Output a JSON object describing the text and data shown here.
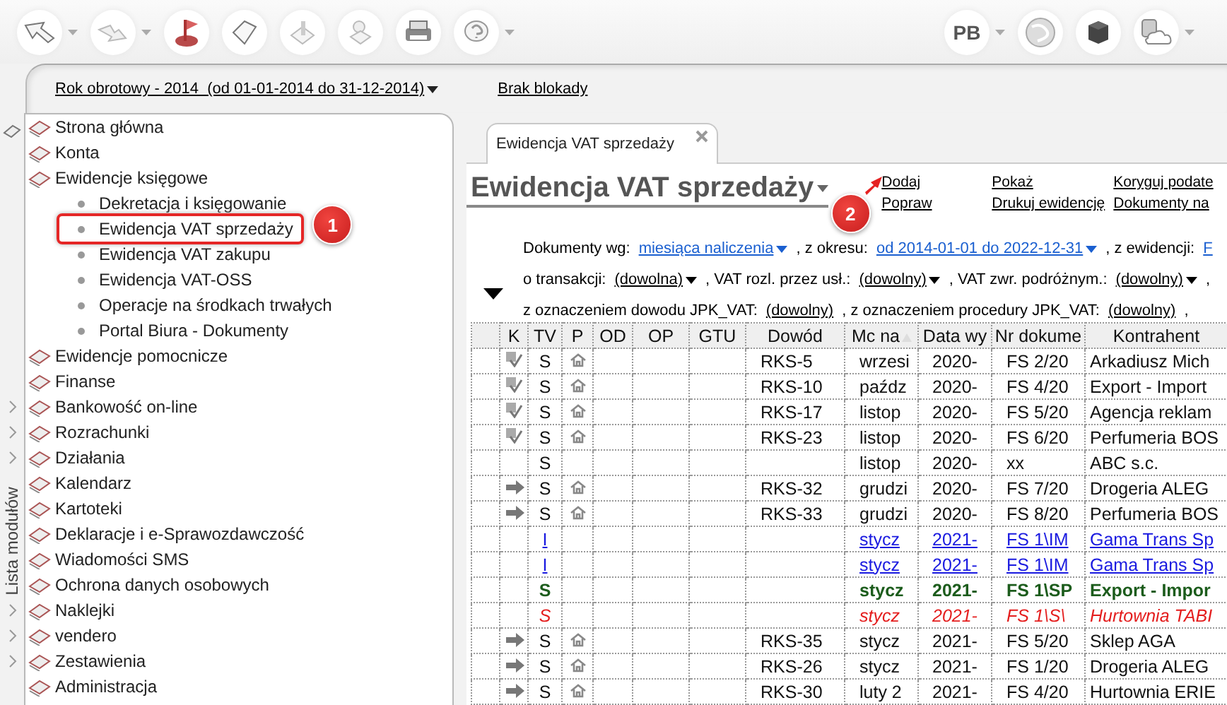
{
  "toolbar": {
    "user_initials": "PB"
  },
  "fiscal_year": {
    "label": "Rok obrotowy - 2014  (od 01-01-2014 do 31-12-2014)",
    "lock": "Brak blokady"
  },
  "sidebar": {
    "title": "Lista modułów",
    "items": [
      {
        "label": "Strona główna",
        "expandable": false
      },
      {
        "label": "Konta",
        "expandable": false
      },
      {
        "label": "Ewidencje księgowe",
        "expandable": false,
        "children": [
          {
            "label": "Dekretacja i księgowanie"
          },
          {
            "label": "Ewidencja VAT sprzedaży",
            "callout": "1"
          },
          {
            "label": "Ewidencja VAT zakupu"
          },
          {
            "label": "Ewidencja VAT-OSS"
          },
          {
            "label": "Operacje na środkach trwałych"
          },
          {
            "label": "Portal Biura - Dokumenty"
          }
        ]
      },
      {
        "label": "Ewidencje pomocnicze",
        "expandable": false
      },
      {
        "label": "Finanse",
        "expandable": false
      },
      {
        "label": "Bankowość on-line",
        "expandable": true
      },
      {
        "label": "Rozrachunki",
        "expandable": true
      },
      {
        "label": "Działania",
        "expandable": true
      },
      {
        "label": "Kalendarz",
        "expandable": false
      },
      {
        "label": "Kartoteki",
        "expandable": false
      },
      {
        "label": "Deklaracje i e-Sprawozdawczość",
        "expandable": false
      },
      {
        "label": "Wiadomości SMS",
        "expandable": false
      },
      {
        "label": "Ochrona danych osobowych",
        "expandable": false
      },
      {
        "label": "Naklejki",
        "expandable": true
      },
      {
        "label": "vendero",
        "expandable": true
      },
      {
        "label": "Zestawienia",
        "expandable": true
      },
      {
        "label": "Administracja",
        "expandable": false
      }
    ]
  },
  "tabs": [
    {
      "label": "Ewidencja VAT sprzedaży",
      "selected": true
    }
  ],
  "view": {
    "title": "Ewidencja VAT sprzedaży",
    "actions": [
      [
        {
          "label": "Dodaj",
          "callout": "2"
        },
        {
          "label": "Popraw"
        }
      ],
      [
        {
          "label": "Pokaż"
        },
        {
          "label": "Drukuj ewidencję"
        }
      ],
      [
        {
          "label": "Koryguj podate"
        },
        {
          "label": "Dokumenty na"
        }
      ]
    ],
    "filters": [
      [
        {
          "kind": "label",
          "text": "Dokumenty wg:"
        },
        {
          "kind": "link",
          "text": "miesiąca naliczenia",
          "dropdown": true
        },
        {
          "kind": "label",
          "text": ", z okresu:"
        },
        {
          "kind": "link",
          "text": "od 2014-01-01 do 2022-12-31",
          "dropdown": true
        },
        {
          "kind": "label",
          "text": ", z ewidencji:"
        },
        {
          "kind": "link",
          "text": "F",
          "dropdown": false
        }
      ],
      [
        {
          "kind": "label",
          "text": "o transakcji:"
        },
        {
          "kind": "value",
          "text": "(dowolna)",
          "dropdown": true
        },
        {
          "kind": "label",
          "text": ", VAT rozl. przez usł.:"
        },
        {
          "kind": "value",
          "text": "(dowolny)",
          "dropdown": true
        },
        {
          "kind": "label",
          "text": ", VAT zwr. podróżnym.:"
        },
        {
          "kind": "value",
          "text": "(dowolny)",
          "dropdown": true
        },
        {
          "kind": "label",
          "text": ","
        }
      ],
      [
        {
          "kind": "label",
          "text": "z oznaczeniem dowodu JPK_VAT:"
        },
        {
          "kind": "value",
          "text": "(dowolny)",
          "dropdown": false
        },
        {
          "kind": "label",
          "text": ", z oznaczeniem procedury JPK_VAT:"
        },
        {
          "kind": "value",
          "text": "(dowolny)",
          "dropdown": false
        },
        {
          "kind": "label",
          "text": ","
        }
      ]
    ]
  },
  "table": {
    "columns": [
      "K",
      "TV",
      "P",
      "OD",
      "OP",
      "GTU",
      "Dowód",
      "Mc na",
      "Data wy",
      "Nr dokume",
      "Kontrahent"
    ],
    "rows": [
      {
        "kind": "normal",
        "checked": true,
        "sent": false,
        "domestic": true,
        "tv": "S",
        "dowod": "RKS-5",
        "month": "wrzesi",
        "date": "2020-",
        "number": "FS 2/20",
        "contractor": "Arkadiusz Mich"
      },
      {
        "kind": "normal",
        "checked": true,
        "sent": false,
        "domestic": true,
        "tv": "S",
        "dowod": "RKS-10",
        "month": "paźdz",
        "date": "2020-",
        "number": "FS 4/20",
        "contractor": "Export - Import"
      },
      {
        "kind": "normal",
        "checked": true,
        "sent": false,
        "domestic": true,
        "tv": "S",
        "dowod": "RKS-17",
        "month": "listop",
        "date": "2020-",
        "number": "FS 5/20",
        "contractor": "Agencja reklam"
      },
      {
        "kind": "normal",
        "checked": true,
        "sent": false,
        "domestic": true,
        "tv": "S",
        "dowod": "RKS-23",
        "month": "listop",
        "date": "2020-",
        "number": "FS 6/20",
        "contractor": "Perfumeria BOS"
      },
      {
        "kind": "normal",
        "checked": false,
        "sent": false,
        "domestic": false,
        "tv": "S",
        "month": "listop",
        "date": "2020-",
        "number": "xx",
        "contractor": "ABC s.c."
      },
      {
        "kind": "normal",
        "checked": false,
        "sent": true,
        "domestic": true,
        "tv": "S",
        "dowod": "RKS-32",
        "month": "grudzi",
        "date": "2020-",
        "number": "FS 7/20",
        "contractor": "Drogeria ALEG"
      },
      {
        "kind": "normal",
        "checked": false,
        "sent": true,
        "domestic": true,
        "tv": "S",
        "dowod": "RKS-33",
        "month": "grudzi",
        "date": "2020-",
        "number": "FS 8/20",
        "contractor": "Perfumeria BOS"
      },
      {
        "kind": "link",
        "checked": false,
        "sent": false,
        "domestic": false,
        "tv": "I",
        "month": "stycz",
        "date": "2021-",
        "number": "FS 1\\IM",
        "contractor": "Gama Trans Sp"
      },
      {
        "kind": "link",
        "checked": false,
        "sent": false,
        "domestic": false,
        "tv": "I",
        "month": "stycz",
        "date": "2021-",
        "number": "FS 1\\IM",
        "contractor": "Gama Trans Sp"
      },
      {
        "kind": "bold",
        "checked": false,
        "sent": false,
        "domestic": false,
        "tv": "S",
        "month": "stycz",
        "date": "2021-",
        "number": "FS 1\\SP",
        "contractor": "Export - Impor"
      },
      {
        "kind": "deleted",
        "checked": false,
        "sent": false,
        "domestic": false,
        "tv": "S",
        "month": "stycz",
        "date": "2021-",
        "number": "FS 1\\S\\",
        "contractor": "Hurtownia TABI"
      },
      {
        "kind": "normal",
        "checked": false,
        "sent": true,
        "domestic": true,
        "tv": "S",
        "dowod": "RKS-35",
        "month": "stycz",
        "date": "2021-",
        "number": "FS 5/20",
        "contractor": "Sklep AGA"
      },
      {
        "kind": "normal",
        "checked": false,
        "sent": true,
        "domestic": true,
        "tv": "S",
        "dowod": "RKS-26",
        "month": "stycz",
        "date": "2021-",
        "number": "FS 1/20",
        "contractor": "Drogeria ALEG"
      },
      {
        "kind": "normal",
        "checked": false,
        "sent": true,
        "domestic": true,
        "tv": "S",
        "dowod": "RKS-30",
        "month": "luty 2",
        "date": "2021-",
        "number": "FS 4/20",
        "contractor": "Hurtownia ERIE"
      }
    ]
  }
}
